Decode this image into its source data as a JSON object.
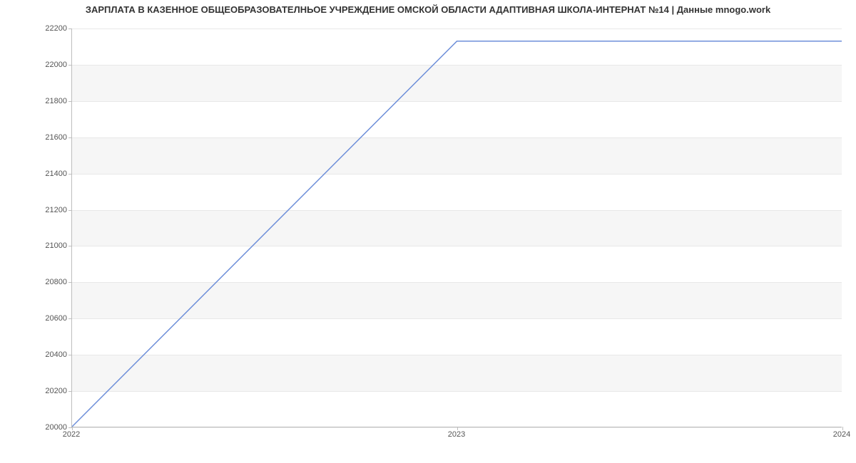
{
  "chart_data": {
    "type": "line",
    "title": "ЗАРПЛАТА В КАЗЕННОЕ ОБЩЕОБРАЗОВАТЕЛНЬОЕ УЧРЕЖДЕНИЕ ОМСКОЙ ОБЛАСТИ АДАПТИВНАЯ ШКОЛА-ИНТЕРНАТ №14 | Данные mnogo.work",
    "xlabel": "",
    "ylabel": "",
    "x": [
      2022,
      2023,
      2024
    ],
    "values": [
      20000,
      22130,
      22130
    ],
    "x_ticks": [
      2022,
      2023,
      2024
    ],
    "y_ticks": [
      20000,
      20200,
      20400,
      20600,
      20800,
      21000,
      21200,
      21400,
      21600,
      21800,
      22000,
      22200
    ],
    "xlim": [
      2022,
      2024
    ],
    "ylim": [
      20000,
      22200
    ],
    "line_color": "#6e8fd9"
  }
}
